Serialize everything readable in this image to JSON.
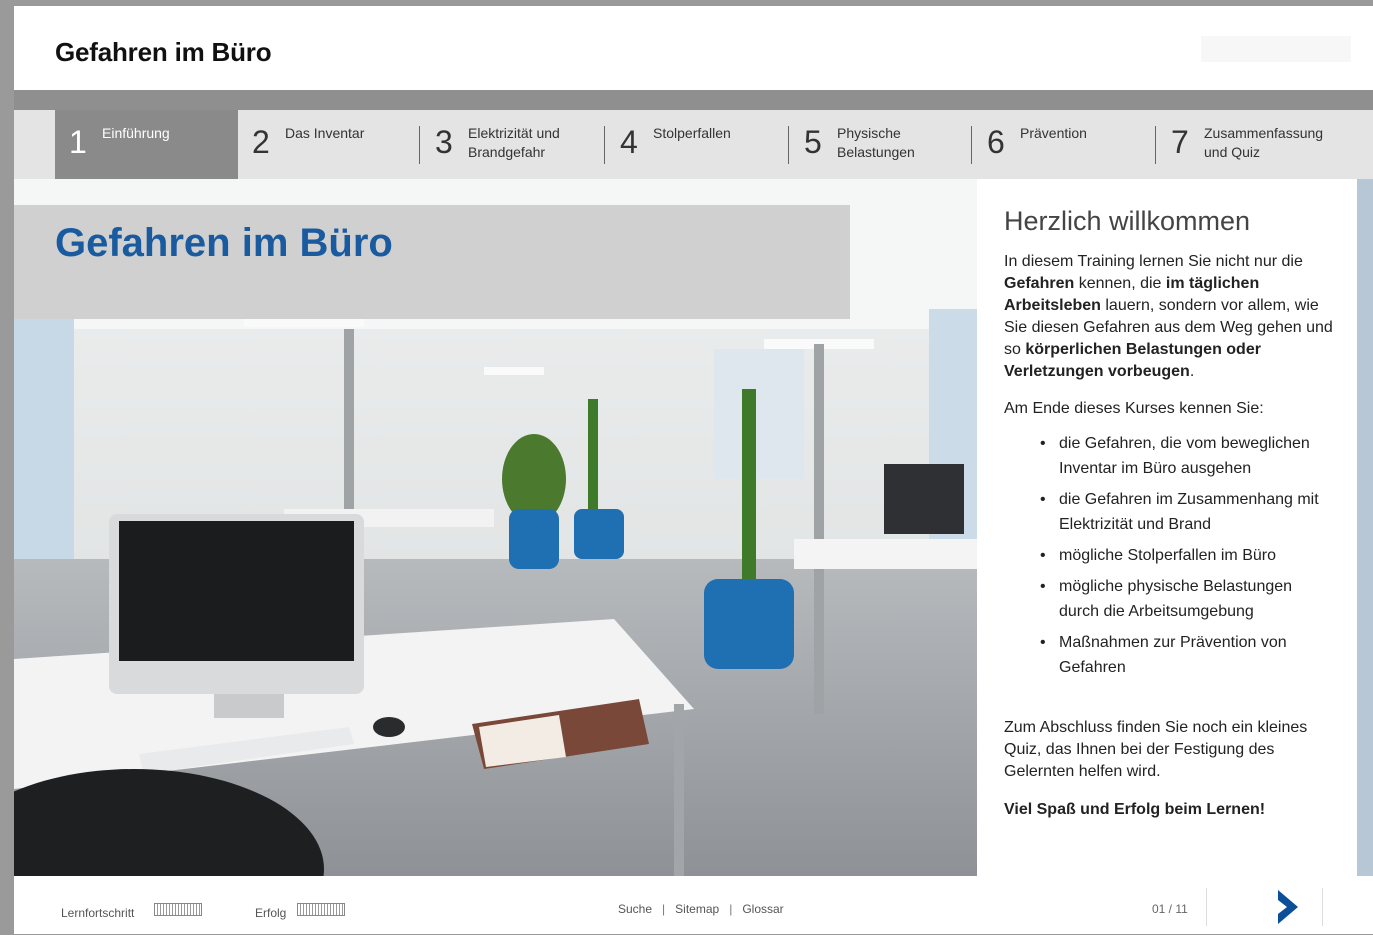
{
  "app_title": "Gefahren im Büro",
  "nav": {
    "tabs": [
      {
        "num": "1",
        "label": "Einführung"
      },
      {
        "num": "2",
        "label": "Das Inventar"
      },
      {
        "num": "3",
        "label": "Elektrizität und Brandgefahr"
      },
      {
        "num": "4",
        "label": "Stolperfallen"
      },
      {
        "num": "5",
        "label": "Physische Belastungen"
      },
      {
        "num": "6",
        "label": "Prävention"
      },
      {
        "num": "7",
        "label": "Zusammenfassung und Quiz"
      }
    ],
    "active_index": 0
  },
  "main": {
    "page_title": "Gefahren im Büro",
    "welcome_heading": "Herzlich willkommen",
    "intro": {
      "p1": "In diesem Training lernen Sie nicht nur die",
      "p2": "Gefahren",
      "p3": " kennen, die ",
      "p4": "im täglichen Arbeitsleben",
      "p5": " lauern, sondern vor allem, wie Sie diesen Gefahren aus dem Weg gehen und so ",
      "p6": "körperlichen Belastungen oder Verletzungen vorbeugen",
      "p7": "."
    },
    "course_end": "Am Ende dieses Kurses kennen Sie:",
    "bullets": [
      "die Gefahren, die vom beweglichen Inventar im Büro ausgehen",
      "die Gefahren im Zusammenhang mit Elektrizität und Brand",
      "mögliche Stolperfallen im Büro",
      "mögliche physische Belastungen durch die Arbeitsumgebung",
      "Maßnahmen zur Prävention von Gefahren"
    ],
    "outro": "Zum Abschluss finden Sie noch ein kleines Quiz, das Ihnen bei der Festigung des Gelernten helfen wird.",
    "closing": "Viel Spaß und Erfolg beim Lernen!"
  },
  "footer": {
    "progress_label": "Lernfortschritt",
    "success_label": "Erfolg",
    "links": [
      "Suche",
      "Sitemap",
      "Glossar"
    ],
    "separator": "|",
    "page_indicator": "01 / 11"
  },
  "colors": {
    "accent_blue": "#1a5a9e",
    "tab_active": "#8a8a8a",
    "tab_bar": "#e4e4e4",
    "next_arrow": "#0a4f98"
  }
}
